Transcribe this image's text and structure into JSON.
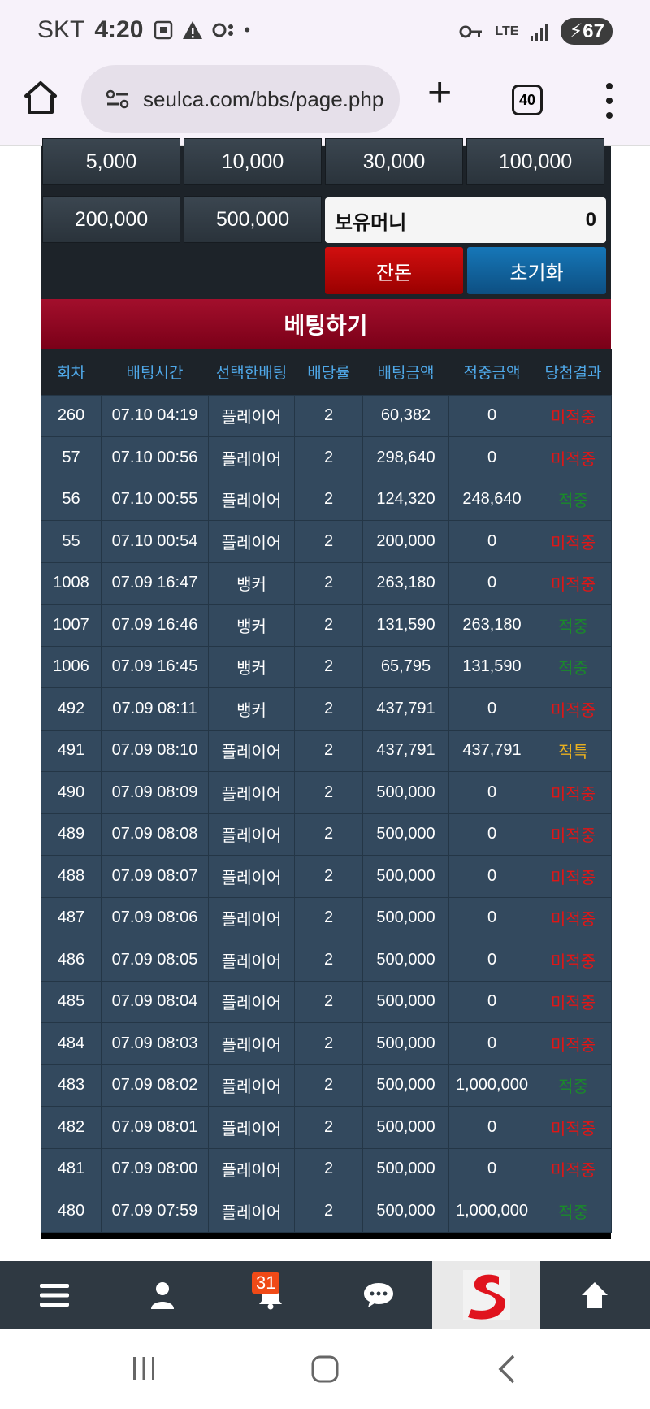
{
  "status_bar": {
    "carrier": "SKT",
    "time": "4:20",
    "network": "LTE",
    "battery": "67"
  },
  "browser": {
    "url": "seulca.com/bbs/page.php",
    "tab_count": "40"
  },
  "chips": [
    "5,000",
    "10,000",
    "30,000",
    "100,000",
    "200,000",
    "500,000"
  ],
  "money": {
    "label": "보유머니",
    "value": "0"
  },
  "buttons": {
    "balance": "잔돈",
    "reset": "초기화"
  },
  "bet_title": "베팅하기",
  "table": {
    "headers": [
      "회차",
      "배팅시간",
      "선택한배팅",
      "배당률",
      "배팅금액",
      "적중금액",
      "당첨결과"
    ],
    "rows": [
      [
        "260",
        "07.10 04:19",
        "플레이어",
        "2",
        "60,382",
        "0",
        "미적중"
      ],
      [
        "57",
        "07.10 00:56",
        "플레이어",
        "2",
        "298,640",
        "0",
        "미적중"
      ],
      [
        "56",
        "07.10 00:55",
        "플레이어",
        "2",
        "124,320",
        "248,640",
        "적중"
      ],
      [
        "55",
        "07.10 00:54",
        "플레이어",
        "2",
        "200,000",
        "0",
        "미적중"
      ],
      [
        "1008",
        "07.09 16:47",
        "뱅커",
        "2",
        "263,180",
        "0",
        "미적중"
      ],
      [
        "1007",
        "07.09 16:46",
        "뱅커",
        "2",
        "131,590",
        "263,180",
        "적중"
      ],
      [
        "1006",
        "07.09 16:45",
        "뱅커",
        "2",
        "65,795",
        "131,590",
        "적중"
      ],
      [
        "492",
        "07.09 08:11",
        "뱅커",
        "2",
        "437,791",
        "0",
        "미적중"
      ],
      [
        "491",
        "07.09 08:10",
        "플레이어",
        "2",
        "437,791",
        "437,791",
        "적특"
      ],
      [
        "490",
        "07.09 08:09",
        "플레이어",
        "2",
        "500,000",
        "0",
        "미적중"
      ],
      [
        "489",
        "07.09 08:08",
        "플레이어",
        "2",
        "500,000",
        "0",
        "미적중"
      ],
      [
        "488",
        "07.09 08:07",
        "플레이어",
        "2",
        "500,000",
        "0",
        "미적중"
      ],
      [
        "487",
        "07.09 08:06",
        "플레이어",
        "2",
        "500,000",
        "0",
        "미적중"
      ],
      [
        "486",
        "07.09 08:05",
        "플레이어",
        "2",
        "500,000",
        "0",
        "미적중"
      ],
      [
        "485",
        "07.09 08:04",
        "플레이어",
        "2",
        "500,000",
        "0",
        "미적중"
      ],
      [
        "484",
        "07.09 08:03",
        "플레이어",
        "2",
        "500,000",
        "0",
        "미적중"
      ],
      [
        "483",
        "07.09 08:02",
        "플레이어",
        "2",
        "500,000",
        "1,000,000",
        "적중"
      ],
      [
        "482",
        "07.09 08:01",
        "플레이어",
        "2",
        "500,000",
        "0",
        "미적중"
      ],
      [
        "481",
        "07.09 08:00",
        "플레이어",
        "2",
        "500,000",
        "0",
        "미적중"
      ],
      [
        "480",
        "07.09 07:59",
        "플레이어",
        "2",
        "500,000",
        "1,000,000",
        "적중"
      ]
    ]
  },
  "appbar": {
    "notification_count": "31",
    "icons": [
      "menu-icon",
      "user-icon",
      "bell-icon",
      "chat-icon",
      "site-logo",
      "arrow-up-icon"
    ]
  },
  "colors": {
    "lose": "#e01616",
    "win": "#1a8a2a",
    "special": "#e8b020",
    "header_red": "#a30f2c",
    "reset_blue": "#1677b8"
  }
}
